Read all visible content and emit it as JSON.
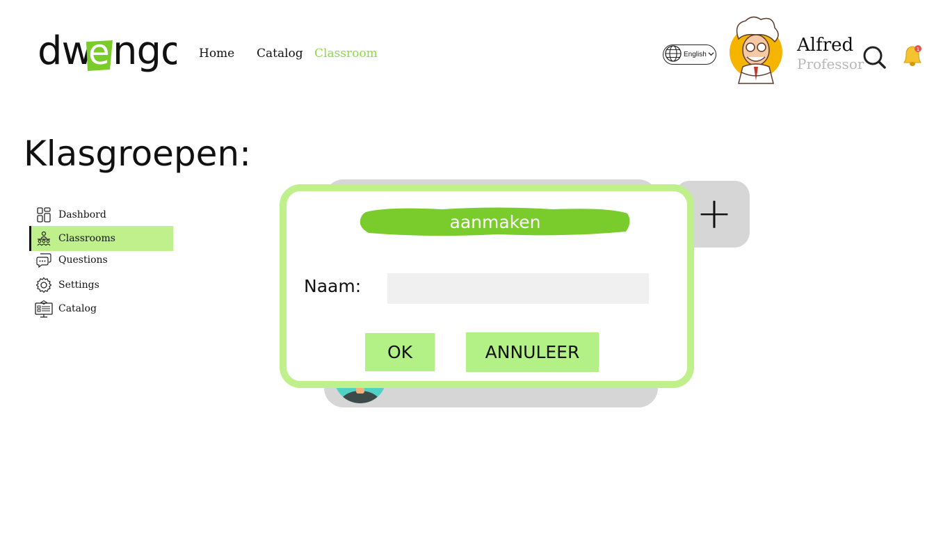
{
  "header": {
    "logo_text": "dwengo",
    "nav": [
      {
        "label": "Home"
      },
      {
        "label": "Catalog"
      },
      {
        "label": "Classroom"
      }
    ],
    "language": "English",
    "user": {
      "name": "Alfred",
      "role": "Professor"
    },
    "notification_count": "1",
    "accent_color": "#8fd84a"
  },
  "page_title": "Klasgroepen:",
  "sidebar": {
    "items": [
      {
        "label": "Dashbord",
        "icon": "dashboard-icon"
      },
      {
        "label": "Classrooms",
        "icon": "classroom-icon"
      },
      {
        "label": "Questions",
        "icon": "chat-icon"
      },
      {
        "label": "Settings",
        "icon": "gear-icon"
      },
      {
        "label": "Catalog",
        "icon": "catalog-icon"
      }
    ],
    "active_color": "#bff08c"
  },
  "add_card": {
    "label": "+"
  },
  "modal": {
    "title": "aanmaken",
    "field_label": "Naam:",
    "field_value": "",
    "ok_label": "OK",
    "cancel_label": "ANNULEER",
    "border_color": "#bff08c",
    "title_color": "#7acb2c"
  }
}
